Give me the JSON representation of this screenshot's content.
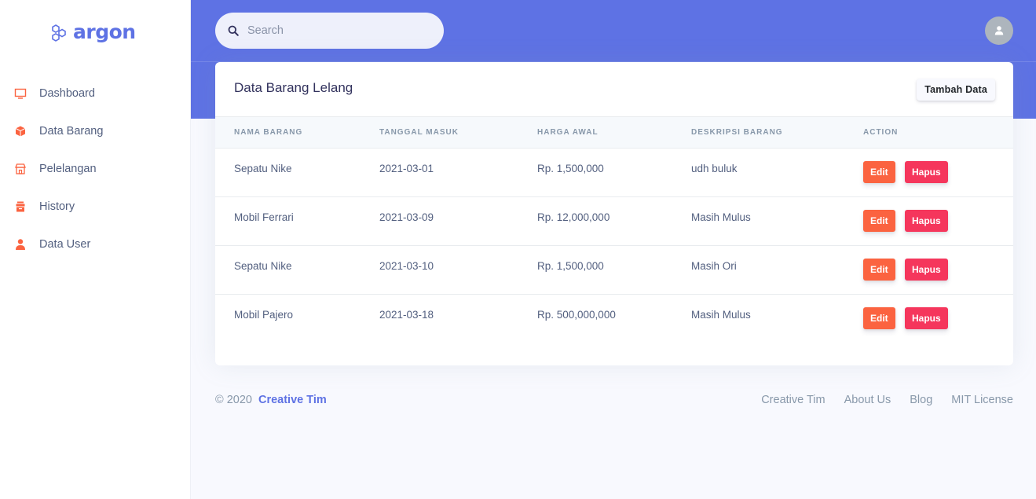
{
  "brand": {
    "name": "argon",
    "icon": "hexagon-cluster-icon",
    "color": "#5e72e4"
  },
  "sidebar": {
    "items": [
      {
        "label": "Dashboard",
        "icon": "monitor-icon"
      },
      {
        "label": "Data Barang",
        "icon": "box-icon"
      },
      {
        "label": "Pelelangan",
        "icon": "shop-icon"
      },
      {
        "label": "History",
        "icon": "archive-icon"
      },
      {
        "label": "Data User",
        "icon": "user-icon"
      }
    ],
    "icon_color": "#fb6340"
  },
  "header": {
    "search": {
      "placeholder": "Search",
      "value": ""
    },
    "avatar": "user-avatar-icon",
    "background": "#5e72e4"
  },
  "card": {
    "title": "Data Barang Lelang",
    "add_button": "Tambah Data",
    "columns": [
      "NAMA BARANG",
      "TANGGAL MASUK",
      "HARGA AWAL",
      "DESKRIPSI BARANG",
      "ACTION"
    ],
    "rows": [
      {
        "nama": "Sepatu Nike",
        "tanggal": "2021-03-01",
        "harga": "Rp. 1,500,000",
        "deskripsi": "udh buluk",
        "edit": "Edit",
        "hapus": "Hapus"
      },
      {
        "nama": "Mobil Ferrari",
        "tanggal": "2021-03-09",
        "harga": "Rp. 12,000,000",
        "deskripsi": "Masih Mulus",
        "edit": "Edit",
        "hapus": "Hapus"
      },
      {
        "nama": "Sepatu Nike",
        "tanggal": "2021-03-10",
        "harga": "Rp. 1,500,000",
        "deskripsi": "Masih Ori",
        "edit": "Edit",
        "hapus": "Hapus"
      },
      {
        "nama": "Mobil Pajero",
        "tanggal": "2021-03-18",
        "harga": "Rp. 500,000,000",
        "deskripsi": "Masih Mulus",
        "edit": "Edit",
        "hapus": "Hapus"
      }
    ]
  },
  "footer": {
    "copyright": "© 2020",
    "brand_link": "Creative Tim",
    "links": [
      "Creative Tim",
      "About Us",
      "Blog",
      "MIT License"
    ]
  }
}
